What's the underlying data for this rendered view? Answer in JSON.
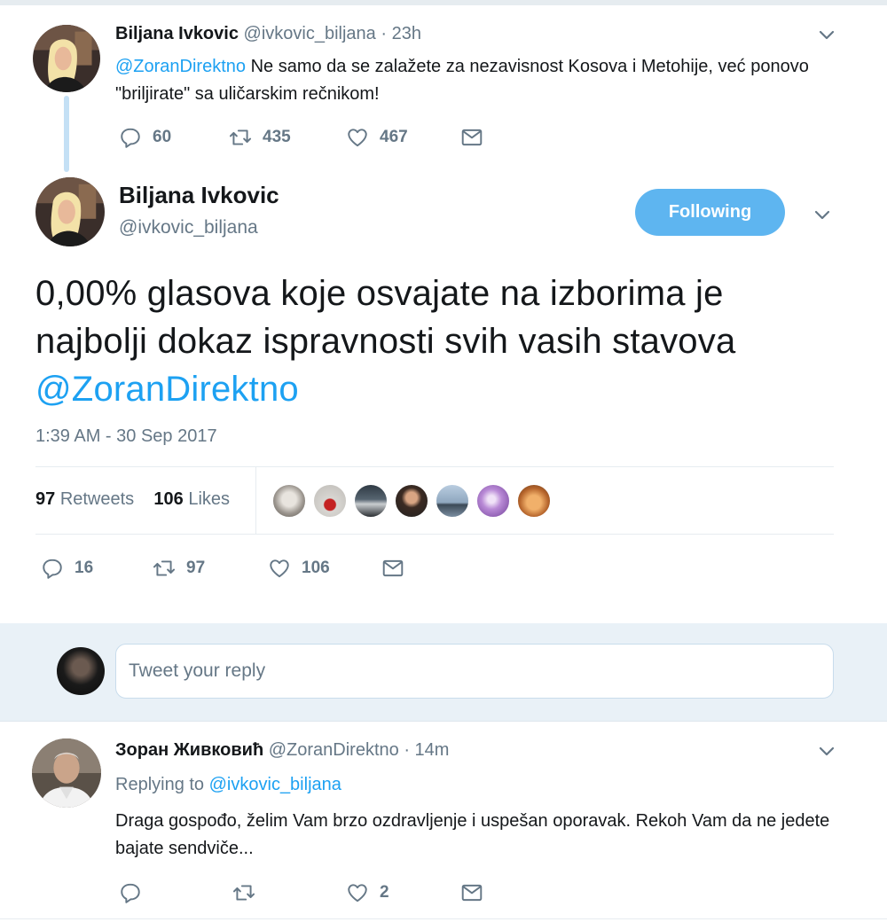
{
  "parent_tweet": {
    "display_name": "Biljana Ivkovic",
    "handle": "@ivkovic_biljana",
    "time": "· 23h",
    "mention": "@ZoranDirektno",
    "text": " Ne samo da se zalažete za nezavisnost Kosova i Metohije, već ponovo \"briljirate\" sa uličarskim rečnikom!",
    "replies": "60",
    "retweets": "435",
    "likes": "467"
  },
  "main_tweet": {
    "display_name": "Biljana Ivkovic",
    "handle": "@ivkovic_biljana",
    "follow_label": "Following",
    "text": "0,00% glasova koje osvajate na izborima je najbolji dokaz ispravnosti svih vasih stavova",
    "mention": "@ZoranDirektno",
    "timestamp": "1:39 AM - 30 Sep 2017",
    "retweet_count": "97",
    "retweet_label": "Retweets",
    "like_count": "106",
    "like_label": "Likes",
    "replies": "16",
    "retweets": "97",
    "likes": "106"
  },
  "reply_box": {
    "placeholder": "Tweet your reply"
  },
  "reply_tweet": {
    "display_name": "Зоран Живковић",
    "handle": "@ZoranDirektno",
    "time": "· 14m",
    "replying_prefix": "Replying to",
    "replying_to": "@ivkovic_biljana",
    "text": "Draga gospođo, želim Vam brzo ozdravljenje i uspešan oporavak. Rekoh Vam da ne jedete bajate sendviče...",
    "likes": "2"
  },
  "colors": {
    "accent": "#1da1f2",
    "follow_button": "#5eb5f0",
    "muted": "#657786",
    "reply_background": "#e9f1f7"
  },
  "icons": [
    "reply-icon",
    "retweet-icon",
    "like-icon",
    "message-icon",
    "chevron-down-icon"
  ]
}
